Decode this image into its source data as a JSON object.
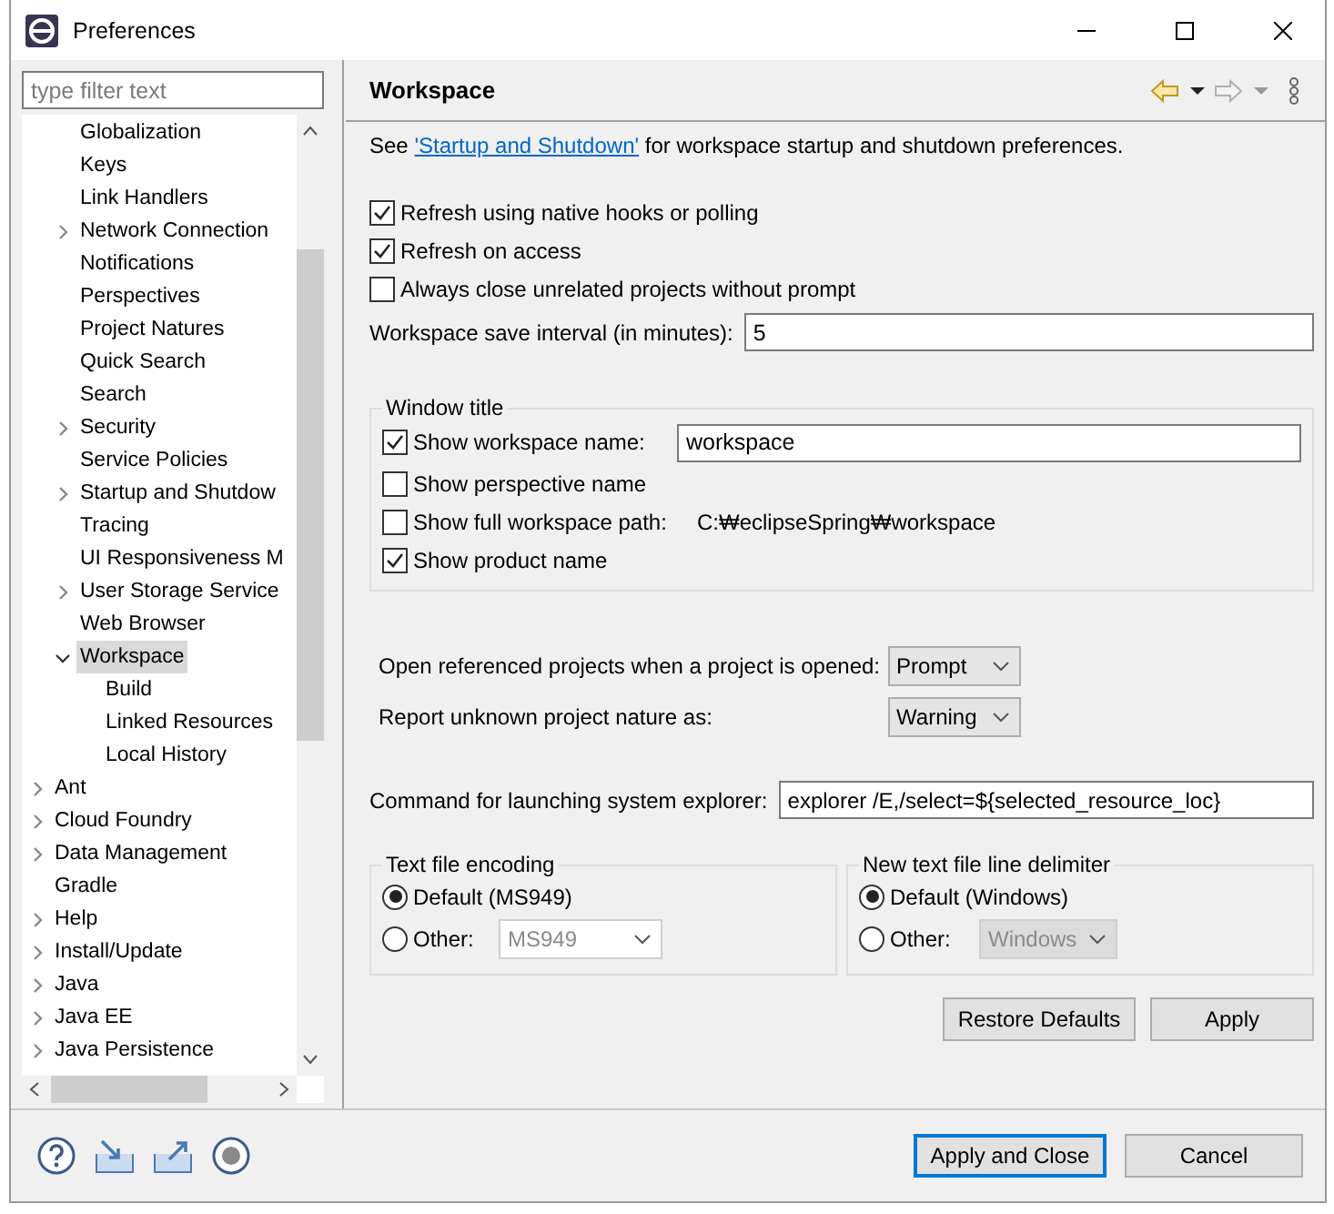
{
  "window": {
    "title": "Preferences"
  },
  "sidebar": {
    "filter": {
      "placeholder": "type filter text"
    },
    "tree": [
      {
        "children": [
          {
            "label": "Globalization",
            "selected": false
          },
          {
            "label": "Keys",
            "selected": false
          },
          {
            "label": "Link Handlers",
            "selected": false
          },
          {
            "label": "Network Connection",
            "expanded": false,
            "selected": false
          },
          {
            "label": "Notifications",
            "selected": false
          },
          {
            "label": "Perspectives",
            "selected": false
          },
          {
            "label": "Project Natures",
            "selected": false
          },
          {
            "label": "Quick Search",
            "selected": false
          },
          {
            "label": "Search",
            "selected": false
          },
          {
            "label": "Security",
            "expanded": false,
            "selected": false
          },
          {
            "label": "Service Policies",
            "selected": false
          },
          {
            "label": "Startup and Shutdow",
            "expanded": false,
            "selected": false
          },
          {
            "label": "Tracing",
            "selected": false
          },
          {
            "label": "UI Responsiveness M",
            "selected": false
          },
          {
            "label": "User Storage Service",
            "expanded": false,
            "selected": false
          },
          {
            "label": "Web Browser",
            "selected": false
          },
          {
            "label": "Workspace",
            "expanded": true,
            "selected": true,
            "children": [
              {
                "label": "Build",
                "selected": false
              },
              {
                "label": "Linked Resources",
                "selected": false
              },
              {
                "label": "Local History",
                "selected": false
              }
            ]
          }
        ]
      },
      {
        "label": "Ant",
        "expanded": false,
        "selected": false
      },
      {
        "label": "Cloud Foundry",
        "expanded": false,
        "selected": false
      },
      {
        "label": "Data Management",
        "expanded": false,
        "selected": false
      },
      {
        "label": "Gradle",
        "selected": false
      },
      {
        "label": "Help",
        "expanded": false,
        "selected": false
      },
      {
        "label": "Install/Update",
        "expanded": false,
        "selected": false
      },
      {
        "label": "Java",
        "expanded": false,
        "selected": false
      },
      {
        "label": "Java EE",
        "expanded": false,
        "selected": false
      },
      {
        "label": "Java Persistence",
        "expanded": false,
        "selected": false
      }
    ]
  },
  "page": {
    "title": "Workspace",
    "intro": {
      "before": "See",
      "link": "'Startup and Shutdown'",
      "after": "for workspace startup and shutdown preferences."
    },
    "checkboxes": [
      {
        "label": "Refresh using native hooks or polling",
        "checked": true
      },
      {
        "label": "Refresh on access",
        "checked": true
      },
      {
        "label": "Always close unrelated projects without prompt",
        "checked": false
      }
    ],
    "save_interval": {
      "label": "Workspace save interval (in minutes):",
      "value": "5"
    },
    "window_title": {
      "title": "Window title",
      "options": [
        {
          "kind": "field",
          "label": "Show workspace name:",
          "checked": true,
          "value": "workspace"
        },
        {
          "kind": "plain",
          "label": "Show perspective name",
          "checked": false
        },
        {
          "kind": "path",
          "label": "Show full workspace path:",
          "checked": false,
          "value": "C:₩eclipseSpring₩workspace"
        },
        {
          "kind": "plain",
          "label": "Show product name",
          "checked": true
        }
      ]
    },
    "selects": [
      {
        "label": "Open referenced projects when a project is opened:",
        "value": "Prompt"
      },
      {
        "label": "Report unknown project nature as:",
        "value": "Warning"
      }
    ],
    "explorer": {
      "label": "Command for launching system explorer:",
      "value": "explorer /E,/select=${selected_resource_loc}"
    },
    "groups": [
      {
        "title": "Text file encoding",
        "options": [
          {
            "kind": "radio",
            "label": "Default (MS949)",
            "selected": true
          },
          {
            "kind": "combo",
            "label": "Other:",
            "selected": false,
            "value": "MS949"
          }
        ]
      },
      {
        "title": "New text file line delimiter",
        "options": [
          {
            "kind": "radio",
            "label": "Default (Windows)",
            "selected": true
          },
          {
            "kind": "readonly_combo",
            "label": "Other:",
            "selected": false,
            "value": "Windows"
          }
        ]
      }
    ],
    "buttons": [
      {
        "label": "Restore Defaults"
      },
      {
        "label": "Apply"
      }
    ]
  },
  "footer": {
    "buttons": [
      {
        "label": "Apply and Close",
        "default": true
      },
      {
        "label": "Cancel",
        "default": false
      }
    ]
  }
}
